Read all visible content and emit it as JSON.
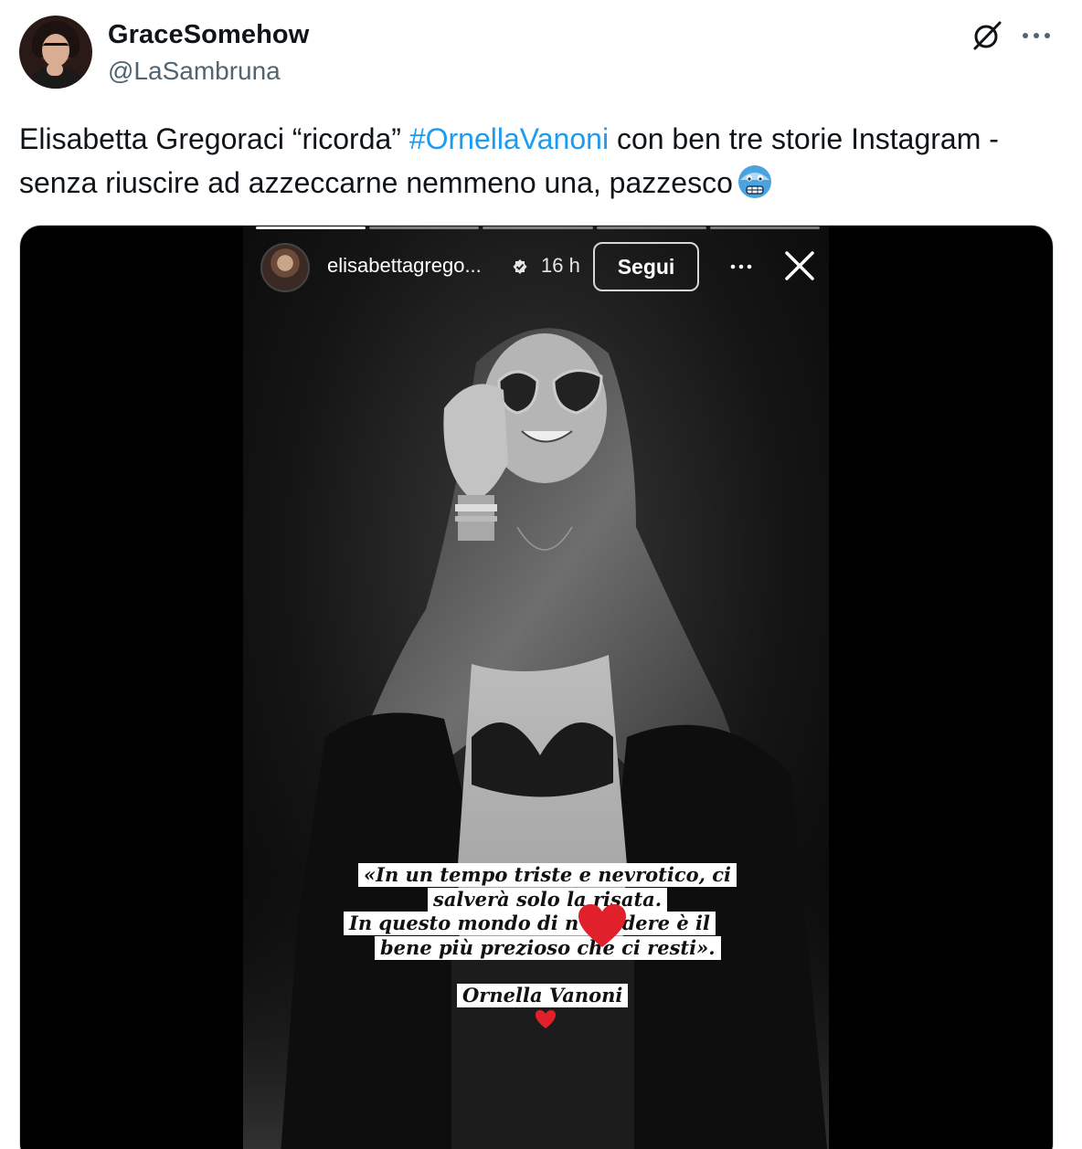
{
  "author": {
    "display_name": "GraceSomehow",
    "handle": "@LaSambruna"
  },
  "icons": {
    "header_action": "grok-icon",
    "more": "more-horizontal-icon",
    "emoji": "cold-face-emoji"
  },
  "tweet": {
    "text_before": "Elisabetta Gregoraci “ricorda” ",
    "hashtag": "#OrnellaVanoni",
    "text_after": " con ben tre storie Instagram - senza riuscire ad azzeccarne nemmeno una, pazzesco"
  },
  "story": {
    "username": "elisabettagrego...",
    "time": "16 h",
    "follow_label": "Segui",
    "progress_segments": 5,
    "progress_completed": 1,
    "caption_lines": [
      "«In un tempo triste e nevrotico, ci",
      "salverà solo la risata.",
      "In questo mondo di n          a ridere è il",
      "bene più prezioso che ci resti».",
      "Ornella Vanoni"
    ]
  },
  "colors": {
    "link": "#1d9bf0",
    "secondary_text": "#536471",
    "border": "#cfd9de",
    "heart": "#e0202a"
  }
}
